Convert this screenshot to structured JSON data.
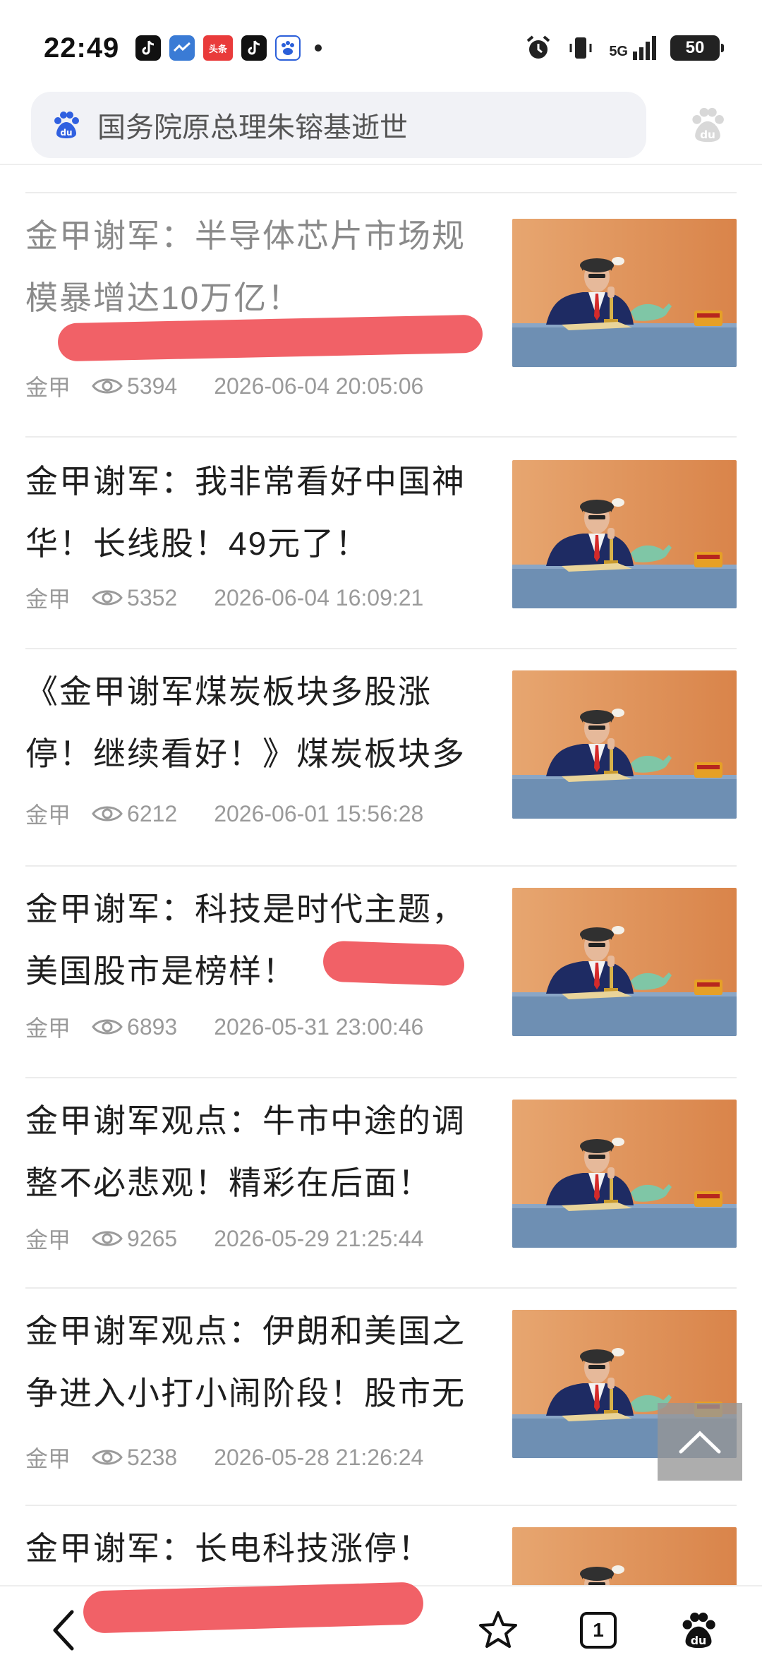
{
  "status_bar": {
    "time": "22:49",
    "apps": [
      "douyin-app-icon",
      "weather-app-icon",
      "toutiao-app-icon",
      "douyin-app-icon",
      "baidu-app-icon"
    ],
    "toutiao_label": "头条",
    "network": "5G",
    "battery": "50"
  },
  "search": {
    "placeholder": "国务院原总理朱镕基逝世"
  },
  "articles": [
    {
      "title": "金甲谢军：半导体芯片市场规模暴增达10万亿！",
      "author": "金甲",
      "views": "5394",
      "date": "2026-06-04 20:05:06",
      "visited": true
    },
    {
      "title": "金甲谢军：我非常看好中国神华！长线股！49元了！",
      "author": "金甲",
      "views": "5352",
      "date": "2026-06-04 16:09:21",
      "visited": false
    },
    {
      "title": "《金甲谢军煤炭板块多股涨停！继续看好！》煤炭板块多",
      "author": "金甲",
      "views": "6212",
      "date": "2026-06-01 15:56:28",
      "visited": false
    },
    {
      "title": "金甲谢军：科技是时代主题，美国股市是榜样！",
      "author": "金甲",
      "views": "6893",
      "date": "2026-05-31 23:00:46",
      "visited": false
    },
    {
      "title": "金甲谢军观点：牛市中途的调整不必悲观！精彩在后面！",
      "author": "金甲",
      "views": "9265",
      "date": "2026-05-29 21:25:44",
      "visited": false
    },
    {
      "title": "金甲谢军观点：伊朗和美国之争进入小打小闹阶段！股市无",
      "author": "金甲",
      "views": "5238",
      "date": "2026-05-28 21:26:24",
      "visited": false
    },
    {
      "title": "金甲谢军：长电科技涨停！",
      "author": "",
      "views": "",
      "date": "",
      "visited": false
    }
  ],
  "bottom_nav": {
    "tabs_count": "1"
  },
  "colors": {
    "redmark": "#ef4b52",
    "thumb_wall": "#d9844a",
    "thumb_table": "#6e8fb3"
  }
}
